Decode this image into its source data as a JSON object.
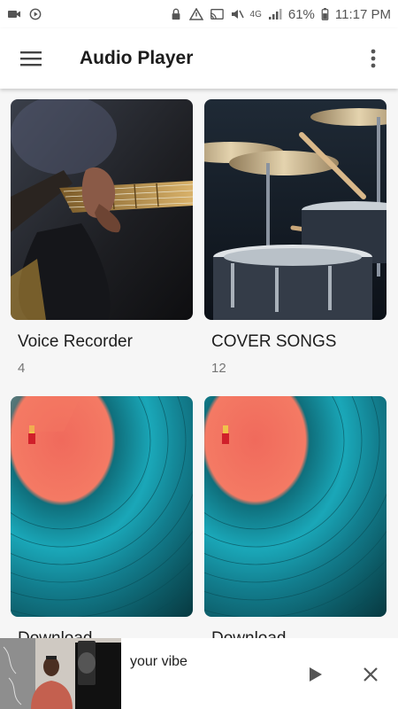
{
  "status_bar": {
    "battery": "61%",
    "time": "11:17 PM",
    "network": "4G"
  },
  "app_bar": {
    "title": "Audio Player",
    "menu_icon": "hamburger-menu-icon",
    "overflow_icon": "more-vertical-icon"
  },
  "albums": [
    {
      "title": "Voice Recorder",
      "count": "4"
    },
    {
      "title": "COVER SONGS",
      "count": "12"
    },
    {
      "title": "Download",
      "count": ""
    },
    {
      "title": "Download",
      "count": ""
    }
  ],
  "mini_player": {
    "track_title": "your vibe",
    "play_icon": "play-icon",
    "close_icon": "close-icon"
  },
  "colors": {
    "background": "#f6f6f6",
    "vinyl_label": "#f47a64",
    "vinyl_teal": "#1aa7b8"
  }
}
